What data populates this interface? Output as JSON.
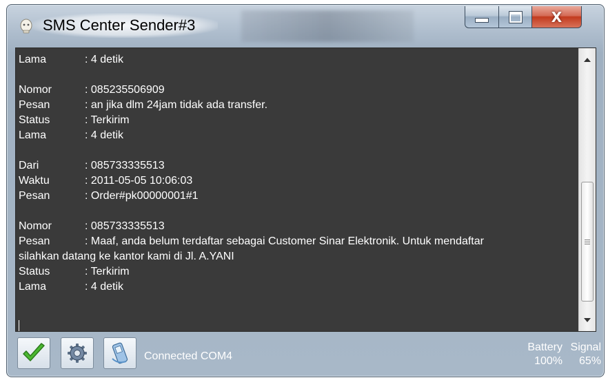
{
  "window": {
    "title": "SMS Center Sender#3",
    "controls": {
      "minimize_icon": "minimize-icon",
      "maximize_icon": "maximize-icon",
      "close_glyph": "X"
    }
  },
  "log": {
    "lines": [
      {
        "key": "Lama",
        "value": ": 4 detik"
      },
      {
        "gap": true
      },
      {
        "key": "Nomor",
        "value": ": 085235506909"
      },
      {
        "key": "Pesan",
        "value": ": an jika dlm 24jam tidak ada transfer."
      },
      {
        "key": "Status",
        "value": ": Terkirim"
      },
      {
        "key": "Lama",
        "value": ": 4 detik"
      },
      {
        "gap": true
      },
      {
        "key": "Dari",
        "value": ": 085733335513"
      },
      {
        "key": "Waktu",
        "value": ": 2011-05-05 10:06:03"
      },
      {
        "key": "Pesan",
        "value": ": Order#pk00000001#1"
      },
      {
        "gap": true
      },
      {
        "key": "Nomor",
        "value": ": 085733335513"
      },
      {
        "key": "Pesan",
        "value": ": Maaf, anda belum terdaftar sebagai Customer Sinar Elektronik. Untuk mendaftar"
      },
      {
        "cont": "silahkan datang ke kantor kami di Jl. A.YANI"
      },
      {
        "key": "Status",
        "value": ": Terkirim"
      },
      {
        "key": "Lama",
        "value": ": 4 detik"
      }
    ]
  },
  "toolbar": {
    "start_icon": "checkmark-icon",
    "settings_icon": "gear-icon",
    "modem_icon": "phone-icon",
    "status": "Connected COM4"
  },
  "meters": {
    "battery_label": "Battery",
    "battery_value": "100%",
    "signal_label": "Signal",
    "signal_value": "65%"
  },
  "colors": {
    "log_background": "#3a3a3a",
    "log_text": "#ffffff",
    "close_button": "#c23b1e",
    "check_green": "#3a9a2a"
  }
}
